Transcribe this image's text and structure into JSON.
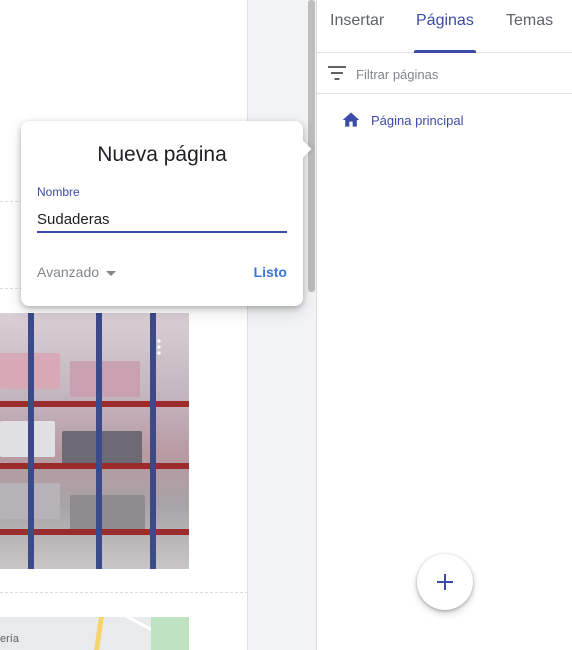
{
  "tabs": [
    {
      "label": "Insertar",
      "active": false
    },
    {
      "label": "Páginas",
      "active": true
    },
    {
      "label": "Temas",
      "active": false
    }
  ],
  "filter": {
    "placeholder": "Filtrar páginas",
    "icon": "filter-icon"
  },
  "pages": [
    {
      "label": "Página principal",
      "icon": "home-icon"
    }
  ],
  "dialog": {
    "title": "Nueva página",
    "name_label": "Nombre",
    "name_value": "Sudaderas",
    "advanced_label": "Avanzado",
    "done_label": "Listo"
  },
  "map": {
    "label": "ería"
  },
  "colors": {
    "accent": "#3c4aa8",
    "done": "#3b78d8"
  }
}
